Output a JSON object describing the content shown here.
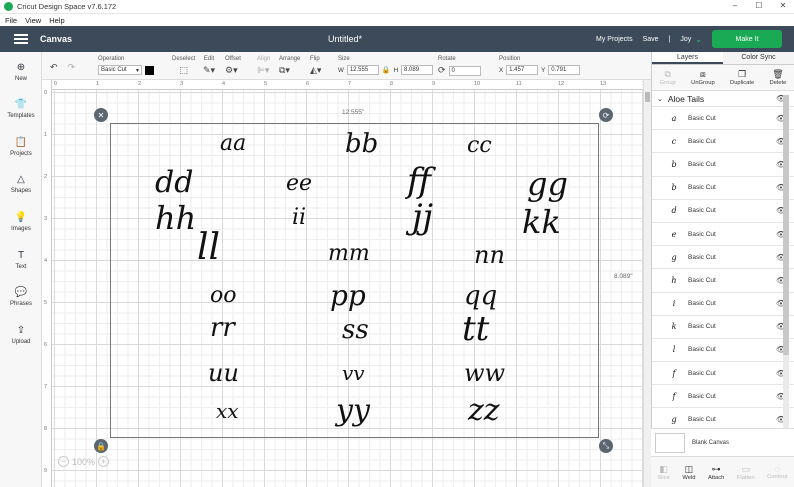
{
  "window": {
    "title": "Cricut Design Space  v7.6.172",
    "controls": [
      "–",
      "☐",
      "✕"
    ]
  },
  "menu": [
    "File",
    "View",
    "Help"
  ],
  "header": {
    "section": "Canvas",
    "doc_title": "Untitled*",
    "my_projects": "My Projects",
    "save": "Save",
    "divider": "|",
    "user": "Joy",
    "make_it": "Make It"
  },
  "toolbar": {
    "operation_label": "Operation",
    "operation_value": "Basic Cut",
    "deselect": "Deselect",
    "edit": "Edit",
    "offset": "Offset",
    "align": "Align",
    "arrange": "Arrange",
    "flip": "Flip",
    "size_label": "Size",
    "w_label": "W",
    "w_value": "12.555",
    "h_label": "H",
    "h_value": "8.089",
    "rotate_label": "Rotate",
    "rotate_value": "0",
    "position_label": "Position",
    "x_label": "X",
    "x_value": "1.457",
    "y_label": "Y",
    "y_value": "0.791"
  },
  "left_tools": [
    "New",
    "Templates",
    "Projects",
    "Shapes",
    "Images",
    "Text",
    "Phrases",
    "Upload"
  ],
  "ruler": {
    "top": [
      "0",
      "1",
      "2",
      "3",
      "4",
      "5",
      "6",
      "7",
      "8",
      "9",
      "10",
      "11",
      "12",
      "13",
      "14"
    ],
    "left": [
      "0",
      "1",
      "2",
      "3",
      "4",
      "5",
      "6",
      "7",
      "8",
      "9"
    ]
  },
  "canvas": {
    "width_label": "12.555\"",
    "height_label": "8.089\"",
    "zoom": "100%",
    "zoom_minus": "−",
    "zoom_plus": "+",
    "letters": [
      [
        "aa",
        "bb",
        "cc"
      ],
      [
        "dd",
        "ee",
        "ff",
        "gg"
      ],
      [
        "hh",
        "ii",
        "jj",
        "kk"
      ],
      [
        "ll",
        "mm",
        "nn"
      ],
      [
        "oo",
        "pp",
        "qq"
      ],
      [
        "rr",
        "ss",
        "tt"
      ],
      [
        "uu",
        "vv",
        "ww"
      ],
      [
        "xx",
        "yy",
        "zz"
      ]
    ]
  },
  "right_panel": {
    "tabs": [
      "Layers",
      "Color Sync"
    ],
    "actions": [
      "Group",
      "UnGroup",
      "Duplicate",
      "Delete"
    ],
    "group_name": "Aloe Tails",
    "layer_label": "Basic Cut",
    "layer_thumbs": [
      "a",
      "c",
      "b",
      "b",
      "d",
      "e",
      "g",
      "h",
      "i",
      "k",
      "l",
      "f",
      "f",
      "g"
    ],
    "blank_canvas": "Blank Canvas",
    "bottom_actions": [
      "Slice",
      "Weld",
      "Attach",
      "Flatten",
      "Contour"
    ]
  },
  "colors": {
    "header_bg": "#3c4a5a",
    "accent_green": "#1aaa55"
  }
}
